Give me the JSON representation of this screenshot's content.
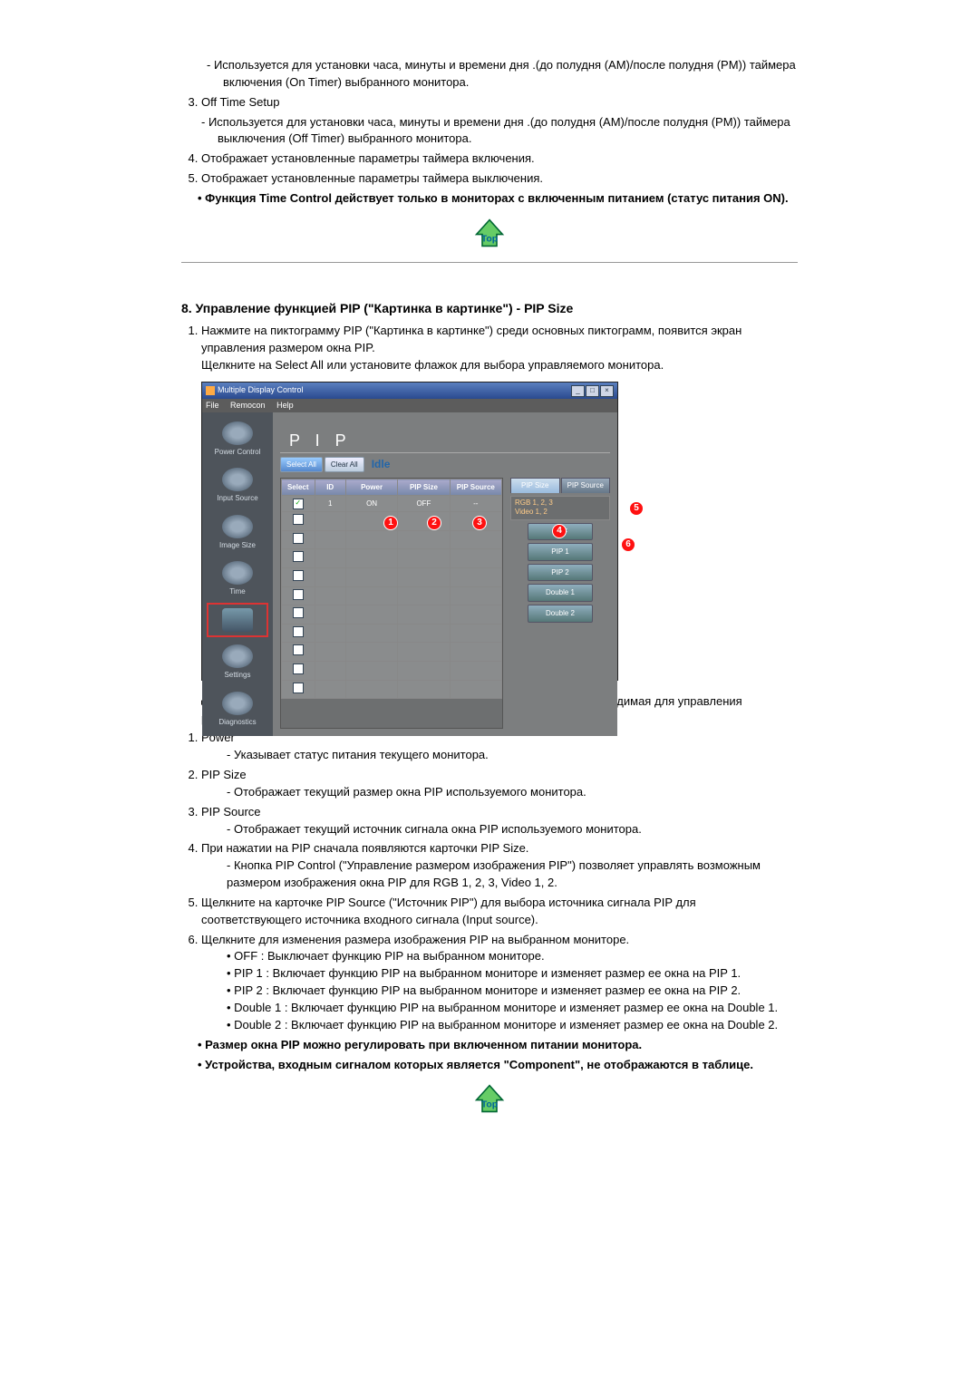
{
  "intro": {
    "note_timer_on": "Используется для установки часа, минуты и времени дня .(до полудня (AM)/после полудня (PM)) таймера включения (On Timer) выбранного монитора.",
    "off_time_setup": "Off Time Setup",
    "note_timer_off": "Используется для установки часа, минуты и времени дня .(до полудня (AM)/после полудня (PM)) таймера выключения (Off Timer) выбранного монитора.",
    "item4": "Отображает установленные параметры таймера включения.",
    "item5": "Отображает установленные параметры таймера выключения.",
    "bullet_bold": "Функция Time Control действует только в мониторах с включенным питанием (статус питания ON)."
  },
  "section8": {
    "title": "8. Управление функцией PIP (\"Картинка в картинке\") - PIP Size",
    "step1": "Нажмите на пиктограмму PIP (\"Картинка в картинке\") среди основных пиктограмм, появится экран управления размером окна PIP.",
    "step1b": "Щелкните на Select All или установите флажок для выбора управляемого монитора.",
    "arrow": "В информационной таблице отображается основная информация, необходимая для управления размером изображения окна PIP.",
    "p1_title": "Power",
    "p1_desc": "Указывает статус питания текущего монитора.",
    "p2_title": "PIP Size",
    "p2_desc": "Отображает текущий размер окна PIP используемого монитора.",
    "p3_title": "PIP Source",
    "p3_desc": "Отображает текущий источник сигнала окна PIP используемого монитора.",
    "p4_title": "При нажатии на PIP сначала появляются карточки PIP Size.",
    "p4_desc": "Кнопка PIP Control (\"Управление размером изображения PIP\") позволяет управлять возможным размером изображения окна PIP для RGB 1, 2, 3, Video 1, 2.",
    "p5": "Щелкните на карточке PIP Source (\"Источник PIP\") для выбора источника сигнала PIP для соответствующего источника входного сигнала (Input source).",
    "p6": "Щелкните для изменения размера изображения PIP на выбранном мониторе.",
    "p6_off": "OFF : Выключает функцию PIP на выбранном мониторе.",
    "p6_pip1": "PIP 1 : Включает функцию PIP на выбранном мониторе и изменяет размер ее окна на PIP 1.",
    "p6_pip2": "PIP 2 : Включает функцию PIP на выбранном мониторе и изменяет размер ее окна на PIP 2.",
    "p6_d1": "Double 1 : Включает функцию PIP на выбранном мониторе и изменяет размер ее окна на Double 1.",
    "p6_d2": "Double 2 : Включает функцию PIP на выбранном мониторе и изменяет размер ее окна на Double 2.",
    "bold1": "Размер окна PIP можно регулировать при включенном питании монитора.",
    "bold2": "Устройства, входным сигналом которых является \"Component\", не отображаются в таблице."
  },
  "app": {
    "title": "Multiple Display Control",
    "menu": {
      "file": "File",
      "remocon": "Remocon",
      "help": "Help"
    },
    "sidebar": [
      "Power Control",
      "Input Source",
      "Image Size",
      "Time",
      "PIP",
      "Settings",
      "Diagnostics"
    ],
    "header": "P I P",
    "buttons": {
      "select_all": "Select All",
      "clear_all": "Clear All",
      "idle": "Idle"
    },
    "cols": {
      "select": "Select",
      "id": "ID",
      "power": "Power",
      "pipsize": "PIP Size",
      "pipsource": "PIP Source"
    },
    "row1": {
      "id": "1",
      "power": "ON",
      "size": "OFF",
      "source": "--"
    },
    "tabs": {
      "size": "PIP Size",
      "source": "PIP Source"
    },
    "info": "RGB 1, 2, 3\nVideo 1, 2",
    "sizes": [
      "OFF",
      "PIP 1",
      "PIP 2",
      "Double 1",
      "Double 2"
    ],
    "markers": [
      "1",
      "2",
      "3",
      "4",
      "5",
      "6"
    ]
  }
}
